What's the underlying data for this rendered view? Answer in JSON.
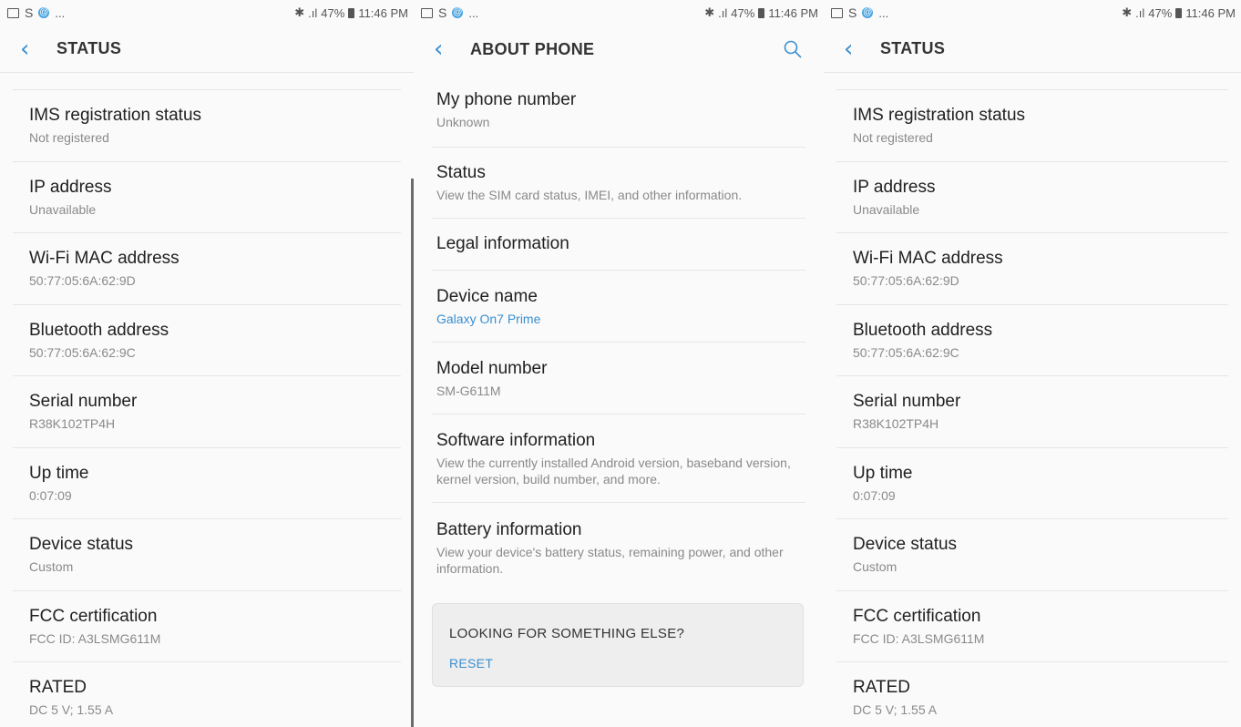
{
  "statusbar": {
    "s_glyph": "S",
    "at_glyph": "@",
    "dots": "...",
    "bluetooth_glyph": "✱",
    "signal": ".ıl",
    "battery_percent": "47%",
    "time": "11:46 PM"
  },
  "left": {
    "title": "STATUS",
    "items": [
      {
        "title": "IMS registration status",
        "sub": "Not registered"
      },
      {
        "title": "IP address",
        "sub": "Unavailable"
      },
      {
        "title": "Wi-Fi MAC address",
        "sub": "50:77:05:6A:62:9D"
      },
      {
        "title": "Bluetooth address",
        "sub": "50:77:05:6A:62:9C"
      },
      {
        "title": "Serial number",
        "sub": "R38K102TP4H"
      },
      {
        "title": "Up time",
        "sub": "0:07:09"
      },
      {
        "title": "Device status",
        "sub": "Custom"
      },
      {
        "title": "FCC certification",
        "sub": "FCC ID: A3LSMG611M"
      },
      {
        "title": "RATED",
        "sub": "DC 5 V; 1.55 A"
      }
    ]
  },
  "middle": {
    "title": "ABOUT PHONE",
    "items": [
      {
        "title": "My phone number",
        "sub": "Unknown"
      },
      {
        "title": "Status",
        "sub": "View the SIM card status, IMEI, and other information."
      },
      {
        "title": "Legal information"
      },
      {
        "title": "Device name",
        "sub": "Galaxy On7 Prime"
      },
      {
        "title": "Model number",
        "sub": "SM-G611M"
      },
      {
        "title": "Software information",
        "sub": "View the currently installed Android version, baseband version, kernel version, build number, and more."
      },
      {
        "title": "Battery information",
        "sub": "View your device's battery status, remaining power, and other information."
      }
    ],
    "looking": {
      "title": "LOOKING FOR SOMETHING ELSE?",
      "reset": "RESET"
    }
  },
  "right": {
    "title": "STATUS",
    "items": [
      {
        "title": "IMS registration status",
        "sub": "Not registered"
      },
      {
        "title": "IP address",
        "sub": "Unavailable"
      },
      {
        "title": "Wi-Fi MAC address",
        "sub": "50:77:05:6A:62:9D"
      },
      {
        "title": "Bluetooth address",
        "sub": "50:77:05:6A:62:9C"
      },
      {
        "title": "Serial number",
        "sub": "R38K102TP4H"
      },
      {
        "title": "Up time",
        "sub": "0:07:09"
      },
      {
        "title": "Device status",
        "sub": "Custom"
      },
      {
        "title": "FCC certification",
        "sub": "FCC ID: A3LSMG611M"
      },
      {
        "title": "RATED",
        "sub": "DC 5 V; 1.55 A"
      }
    ]
  },
  "colors": {
    "accent": "#3a8fd0",
    "background": "#fafafa",
    "secondary_text": "#8a8a8a"
  }
}
